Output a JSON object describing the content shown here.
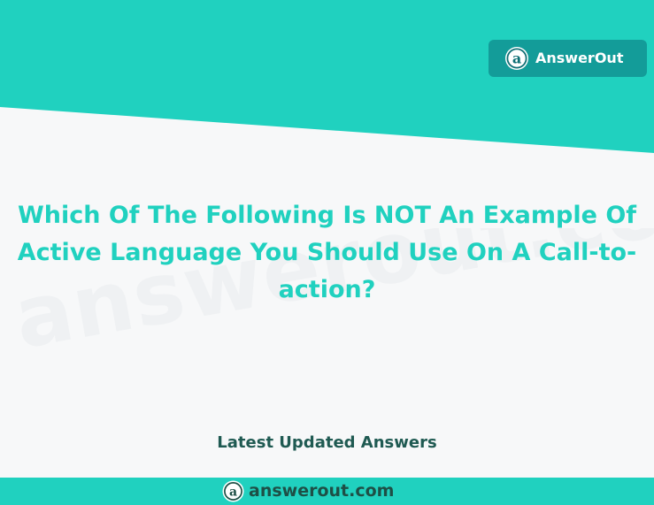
{
  "brand": {
    "name": "AnswerOut",
    "logo_icon": "a-logo-icon"
  },
  "watermark": {
    "text": "answerout.com"
  },
  "question": {
    "title": "Which Of The Following Is NOT An Example Of Active Language You Should Use On A Call-to-action?"
  },
  "section": {
    "label": "Latest Updated Answers"
  },
  "footer": {
    "site": "answerout.com",
    "site_icon": "a-logo-icon"
  },
  "colors": {
    "teal": "#20d1bf",
    "badge_teal": "#139c99",
    "dark_green": "#1f5a52",
    "background": "#f7f8f9"
  }
}
